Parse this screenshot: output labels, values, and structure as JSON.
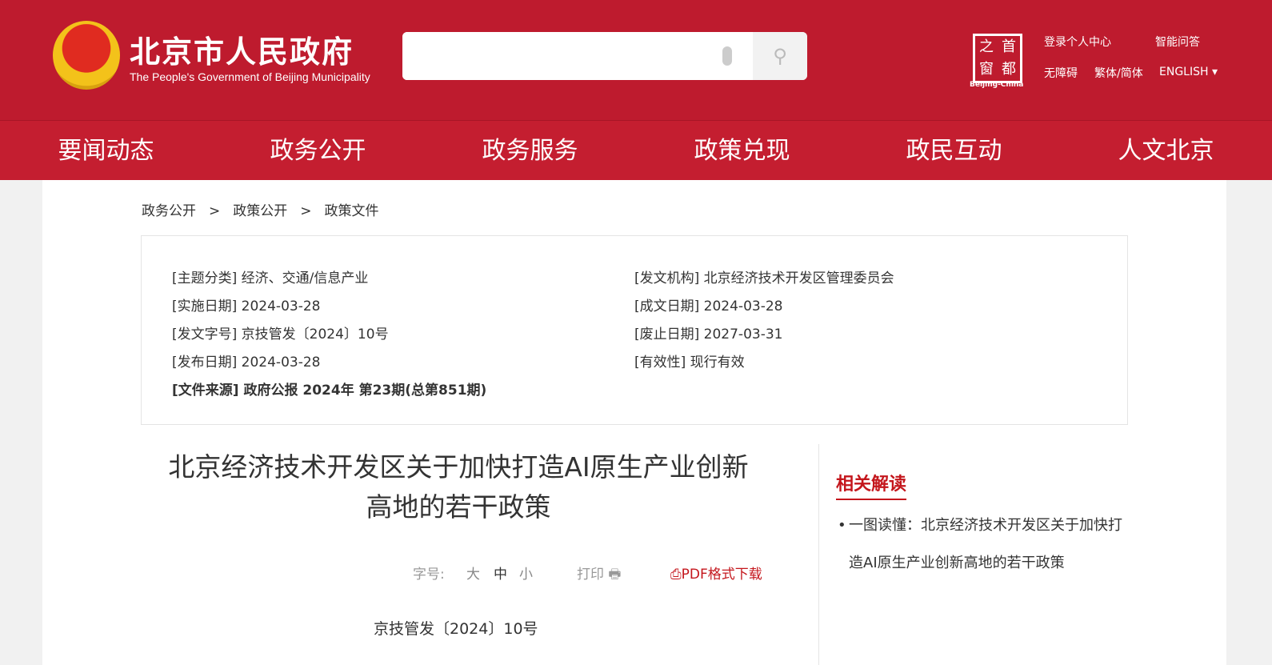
{
  "header": {
    "title": "北京市人民政府",
    "subtitle": "The People's Government of Beijing Municipality",
    "search_placeholder": "",
    "logo_chars": [
      "之",
      "首",
      "窗",
      "都"
    ],
    "logo_sub": "Beijing-China",
    "links": {
      "login": "登录个人中心",
      "qa": "智能问答",
      "accessibility": "无障碍",
      "lang_switch": "繁体/简体",
      "english": "ENGLISH ▾"
    }
  },
  "nav": [
    "要闻动态",
    "政务公开",
    "政务服务",
    "政策兑现",
    "政民互动",
    "人文北京"
  ],
  "breadcrumb": [
    "政务公开",
    ">",
    "政策公开",
    ">",
    "政策文件"
  ],
  "info": {
    "topic": "[主题分类] 经济、交通/信息产业",
    "agency": "[发文机构] 北京经济技术开发区管理委员会",
    "impl_date": "[实施日期] 2024-03-28",
    "made_date": "[成文日期] 2024-03-28",
    "doc_no": "[发文字号] 京技管发〔2024〕10号",
    "abolish_date": "[废止日期] 2027-03-31",
    "pub_date": "[发布日期] 2024-03-28",
    "validity": "[有效性] 现行有效",
    "source": "[文件来源] 政府公报 2024年 第23期(总第851期)"
  },
  "doc": {
    "title_line1": "北京经济技术开发区关于加快打造AI原生产业创新",
    "title_line2": "高地的若干政策",
    "font_label": "字号:",
    "font_large": "大",
    "font_medium": "中",
    "font_small": "小",
    "print": "打印",
    "pdf": "PDF格式下载",
    "doc_number": "京技管发〔2024〕10号"
  },
  "related": {
    "heading": "相关解读",
    "item": "一图读懂：北京经济技术开发区关于加快打造AI原生产业创新高地的若干政策"
  }
}
